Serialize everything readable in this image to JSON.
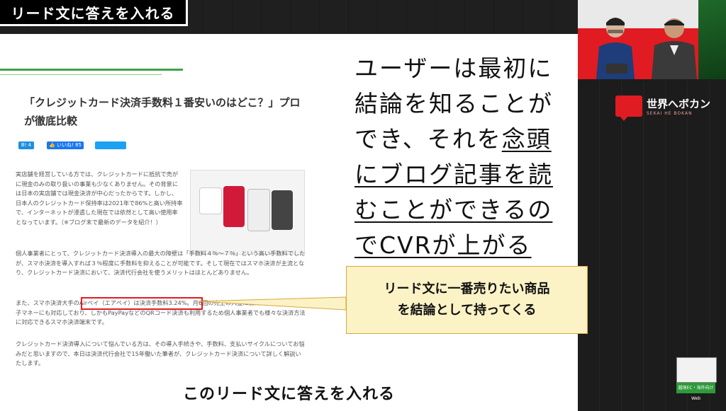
{
  "header": {
    "title": "リード文に答えを入れる"
  },
  "article": {
    "title": "「クレジットカード決済手数料１番安いのはどこ？」プロが徹底比較",
    "share": {
      "hatena": "B! 4",
      "like": "👍 いいね! 85",
      "tweet": "🐦 ツイート"
    },
    "p1": "実店舗を経営している方では、クレジットカードに抵抗で売がに現金のみの取り扱いの事業も少なくありません。その背景には日本の実店舗では現金決済が中心だったからです。しかし、日本人のクレジットカード保持率は2021年で86%と高い所持率で、インターネットが浸透した現在では依然として高い使用率となっています。（※ブログ末で最新のデータを紹介！）",
    "p2": "個人事業者にとって、クレジットカード決済導入の最大の障壁は「手数料４％～７％」という高い手数料でしたが、スマホ決済を導入すれば３％程度に手数料を抑えることが可能です。そして現在ではスマホ決済が主流となり、クレジットカード決済において、決済代行会社を使うメリットはほとんどありません。",
    "p3": "また、スマホ決済大手のAirペイ（エアペイ）は決済手数料3.24%。月6回の売上の入金に加えてSuicaなどの電子マネーにも対応しており、しかもPayPayなどのQRコード決済も利用するため個人事業者でも様々な決済方法に対応できるスマホ決済端末です。",
    "p4": "クレジットカード決済導入について悩んでいる方は、その導入手続きや、手数料、支払いサイクルについてお悩みだと思いますので、本日は決済代行会社で15年働いた筆者が、クレジットカード決済について詳しく解説いたします。"
  },
  "main_text": {
    "line1": "ユーザーは最初に",
    "line2": "結論を知ることが",
    "line3a": "でき、それを",
    "line3b": "念頭",
    "line4": "にブログ記事を読",
    "line5": "むことができるの",
    "line6": "でCVRが上がる"
  },
  "callout": {
    "line1": "リード文に一番売りたい商品",
    "line2": "を結論として持ってくる"
  },
  "brand": {
    "name": "世界へボカン",
    "sub": "SEKAI HE BOKAN"
  },
  "thumb": {
    "label": "越境EC・海外向けWeb"
  },
  "caption": {
    "text": "このリード文に答えを入れる"
  },
  "colors": {
    "accent_red": "#e11b22",
    "green": "#3fa24a",
    "callout_bg": "#fbf2c6"
  }
}
